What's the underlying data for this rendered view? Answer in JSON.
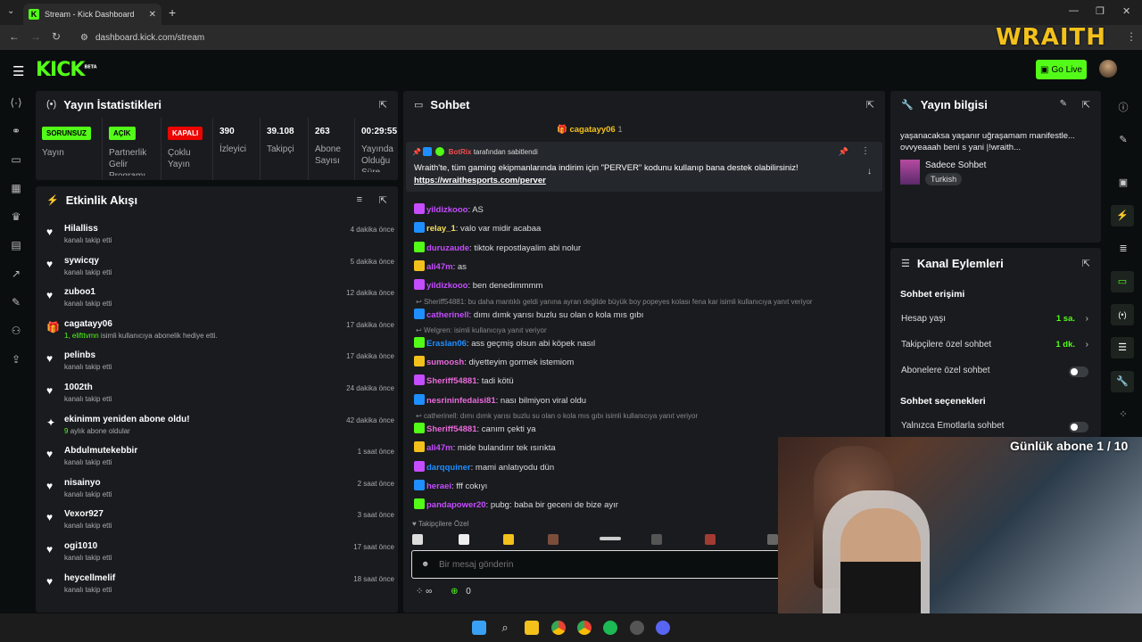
{
  "browser": {
    "tab_title": "Stream - Kick Dashboard",
    "url": "dashboard.kick.com/stream"
  },
  "overlay": {
    "brand": "WRAITH",
    "sub_goal": "Günlük abone 1 / 10"
  },
  "header": {
    "logo": "KICK",
    "logo_sup": "BETA",
    "go_live": "Go Live"
  },
  "stats_panel": {
    "title": "Yayın İstatistikleri",
    "items": [
      {
        "badge": "SORUNSUZ",
        "label": "Yayın",
        "badge_color": "#53fc18"
      },
      {
        "badge": "AÇIK",
        "label": "Partnerlik Gelir Programı",
        "badge_color": "#53fc18"
      },
      {
        "badge": "KAPALI",
        "label": "Çoklu Yayın",
        "badge_color": "#eb0400"
      },
      {
        "value": "390",
        "label": "İzleyici"
      },
      {
        "value": "39.108",
        "label": "Takipçi"
      },
      {
        "value": "263",
        "label": "Abone Sayısı"
      },
      {
        "value": "00:29:55",
        "label": "Yayında Olduğu Süre"
      }
    ]
  },
  "activity": {
    "title": "Etkinlik Akışı",
    "items": [
      {
        "name": "Hilalliss",
        "sub": "kanalı takip etti",
        "time": "4 dakika önce",
        "icon": "heart-icon"
      },
      {
        "name": "sywicqy",
        "sub": "kanalı takip etti",
        "time": "5 dakika önce",
        "icon": "heart-icon"
      },
      {
        "name": "zuboo1",
        "sub": "kanalı takip etti",
        "time": "12 dakika önce",
        "icon": "heart-icon"
      },
      {
        "name": "cagatayy06",
        "sub_hl": "1, elifttvmn",
        "sub": "isimli kullanıcıya abonelik hediye etti.",
        "time": "17 dakika önce",
        "icon": "gift-icon"
      },
      {
        "name": "pelinbs",
        "sub": "kanalı takip etti",
        "time": "17 dakika önce",
        "icon": "heart-icon"
      },
      {
        "name": "1002th",
        "sub": "kanalı takip etti",
        "time": "24 dakika önce",
        "icon": "heart-icon"
      },
      {
        "name": "ekinimm yeniden abone oldu!",
        "sub_hl": "9",
        "sub": "aylık abone oldular",
        "time": "42 dakika önce",
        "icon": "star-icon"
      },
      {
        "name": "Abdulmutekebbir",
        "sub": "kanalı takip etti",
        "time": "1 saat önce",
        "icon": "heart-icon"
      },
      {
        "name": "nisainyo",
        "sub": "kanalı takip etti",
        "time": "2 saat önce",
        "icon": "heart-icon"
      },
      {
        "name": "Vexor927",
        "sub": "kanalı takip etti",
        "time": "3 saat önce",
        "icon": "heart-icon"
      },
      {
        "name": "ogi1010",
        "sub": "kanalı takip etti",
        "time": "17 saat önce",
        "icon": "heart-icon"
      },
      {
        "name": "heycellmelif",
        "sub": "kanalı takip etti",
        "time": "18 saat önce",
        "icon": "heart-icon"
      }
    ]
  },
  "chat": {
    "title": "Sohbet",
    "top_gifter": "cagatayy06",
    "top_gifter_count": "1",
    "pinned_by": "BotRix",
    "pinned_suffix": "tarafından sabitlendi",
    "pinned_text": "Wraith'te, tüm gaming ekipmanlarında indirim için \"PERVER\" kodunu kullanıp bana destek olabilirsiniz!",
    "pinned_link": "https://wraithesports.com/perver",
    "messages": [
      {
        "user": "yildizkooo",
        "color": "#c54cff",
        "text": "AS"
      },
      {
        "user": "relay_1",
        "color": "#f6e05e",
        "text": "valo var midir acabaa"
      },
      {
        "user": "duruzaude",
        "color": "#c54cff",
        "text": "tiktok repostlayalim abi nolur"
      },
      {
        "user": "ali47m",
        "color": "#c54cff",
        "text": "as"
      },
      {
        "user": "yildizkooo",
        "color": "#c54cff",
        "text": "ben denedimmmm"
      },
      {
        "user": "catherinell",
        "color": "#c54cff",
        "text": "dımı dımk yarısı buzlu su olan o kola mıs gıbı",
        "reply": "Sheriff54881: bu daha mantıklı geldi yanına ayran değilde büyük boy popeyes kolası fena kar isimli kullanıcıya yanıt veriyor"
      },
      {
        "user": "Eraslan06",
        "color": "#1f8fff",
        "text": "ass geçmiş olsun abi köpek nasıl",
        "reply": "Welgren:  isimli kullanıcıya yanıt veriyor"
      },
      {
        "user": "sumoosh",
        "color": "#e96bd9",
        "text": "diyetteyim gormek istemiom"
      },
      {
        "user": "Sheriff54881",
        "color": "#e96bd9",
        "text": "tadi kötü"
      },
      {
        "user": "nesrininfedaisi81",
        "color": "#e96bd9",
        "text": "nası bilmiyon viral oldu"
      },
      {
        "user": "Sheriff54881",
        "color": "#e96bd9",
        "text": "canım çekti ya",
        "reply": "catherinell: dımı dımk yarısı buzlu su olan o kola mıs gıbı isimli kullanıcıya yanıt veriyor"
      },
      {
        "user": "ali47m",
        "color": "#c54cff",
        "text": "mide bulandırır tek ısırıkta"
      },
      {
        "user": "darqquiner",
        "color": "#1f8fff",
        "text": "mami anlatıyodu dün"
      },
      {
        "user": "heraei",
        "color": "#c54cff",
        "text": "fff cokıyı"
      },
      {
        "user": "pandapower20",
        "color": "#c54cff",
        "text": "pubg: baba bir geceni de bize ayır"
      }
    ],
    "followers_only": "Takipçilere Özel",
    "input_placeholder": "Bir mesaj gönderin",
    "infinity": "∞",
    "points": "0"
  },
  "stream_info": {
    "title": "Yayın bilgisi",
    "stream_title": "yaşanacaksa yaşanır uğraşamam manifestle... ovvyeaaah beni s yani |!wraith...",
    "category": "Sadece Sohbet",
    "language": "Turkish"
  },
  "channel_actions": {
    "title": "Kanal Eylemleri",
    "chat_access_heading": "Sohbet erişimi",
    "rows": [
      {
        "label": "Hesap yaşı",
        "value": "1 sa."
      },
      {
        "label": "Takipçilere özel sohbet",
        "value": "1 dk."
      }
    ],
    "subs_only_label": "Abonelere özel sohbet",
    "chat_options_heading": "Sohbet seçenekleri",
    "emote_only_label": "Yalnızca Emotlarla sohbet"
  }
}
